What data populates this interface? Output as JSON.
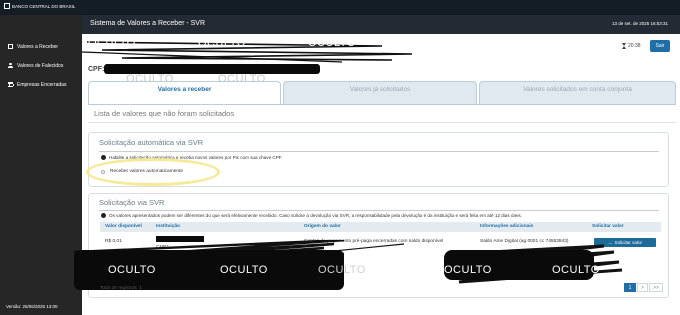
{
  "topbar": {
    "logo_text": "BANCO CENTRAL DO BRASIL"
  },
  "sidebar": {
    "items": [
      {
        "label": "Valores a Receber",
        "icon": "card-icon"
      },
      {
        "label": "Valores de Falecidos",
        "icon": "person-icon"
      },
      {
        "label": "Empresas Encerradas",
        "icon": "building-icon"
      }
    ],
    "version": "Versão: 25/06/2025 13:00"
  },
  "header": {
    "title": "Sistema de Valores a Receber - SVR",
    "datetime": "13 de set. de 2025 16:53:31"
  },
  "masks": {
    "label": "OCULTO"
  },
  "session": {
    "timer": "20:38",
    "logout_label": "Sair"
  },
  "cpf_label": "CPF:",
  "tabs": [
    {
      "label": "Valores a receber",
      "active": true
    },
    {
      "label": "Valores já solicitados",
      "active": false
    },
    {
      "label": "Valores solicitados em conta conjunta",
      "active": false
    }
  ],
  "list_title": "Lista de valores que não foram solicitados",
  "auto_panel": {
    "title": "Solicitação automática via SVR",
    "info": "Habilite a solicitação automática e receba novos valores por Pix com sua chave CPF.",
    "option_label": "Receber valores automaticamente"
  },
  "svr_panel": {
    "title": "Solicitação via SVR",
    "info": "Os valores apresentados podem ser diferentes do que será efetivamente recebido. Caso solicite a devolução via SVR, a responsabilidade pela devolução é da instituição e será feita em até 12 dias úteis.",
    "columns": [
      "Valor disponível",
      "Instituição",
      "Origem do valor",
      "Informações adicionais",
      "Solicitar valor"
    ],
    "rows": [
      {
        "valor": "R$ 0,01",
        "instituicao": "CNPJ",
        "origem": "Contas de pagamento pré-paga encerradas com saldo disponível",
        "info": "Saldo Ame Digital (ag 0001 cc 74553843)",
        "action_label": "Solicitar valor"
      }
    ],
    "total": "Total de registros: 1"
  },
  "pager": {
    "current": "1",
    "next": ">",
    "last": ">>"
  },
  "colors": {
    "accent": "#1f6ea8",
    "sidebar": "#262626",
    "header": "#232a33"
  }
}
